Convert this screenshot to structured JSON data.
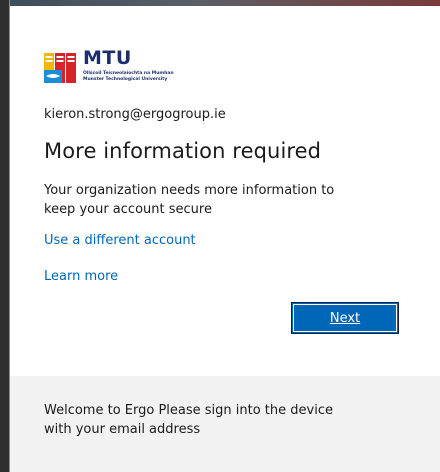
{
  "branding": {
    "logo_name": "MTU",
    "logo_subtitle_line1": "Ollscoil Teicneolaíochta na Mumhan",
    "logo_subtitle_line2": "Munster Technological University",
    "colors": {
      "navy": "#1b2f6e",
      "red": "#d8232a",
      "yellow": "#f2b700",
      "blue": "#1a8fd8"
    }
  },
  "account": {
    "email": "kieron.strong@ergogroup.ie"
  },
  "main": {
    "title": "More information required",
    "description": "Your organization needs more information to keep your account secure",
    "use_different_account_label": "Use a different account",
    "learn_more_label": "Learn more",
    "next_label": "Next"
  },
  "footer": {
    "text": "Welcome to Ergo Please sign into the device with your email address"
  },
  "colors": {
    "link": "#0067b8",
    "button_bg": "#0067b8",
    "footer_bg": "#f2f2f2"
  }
}
